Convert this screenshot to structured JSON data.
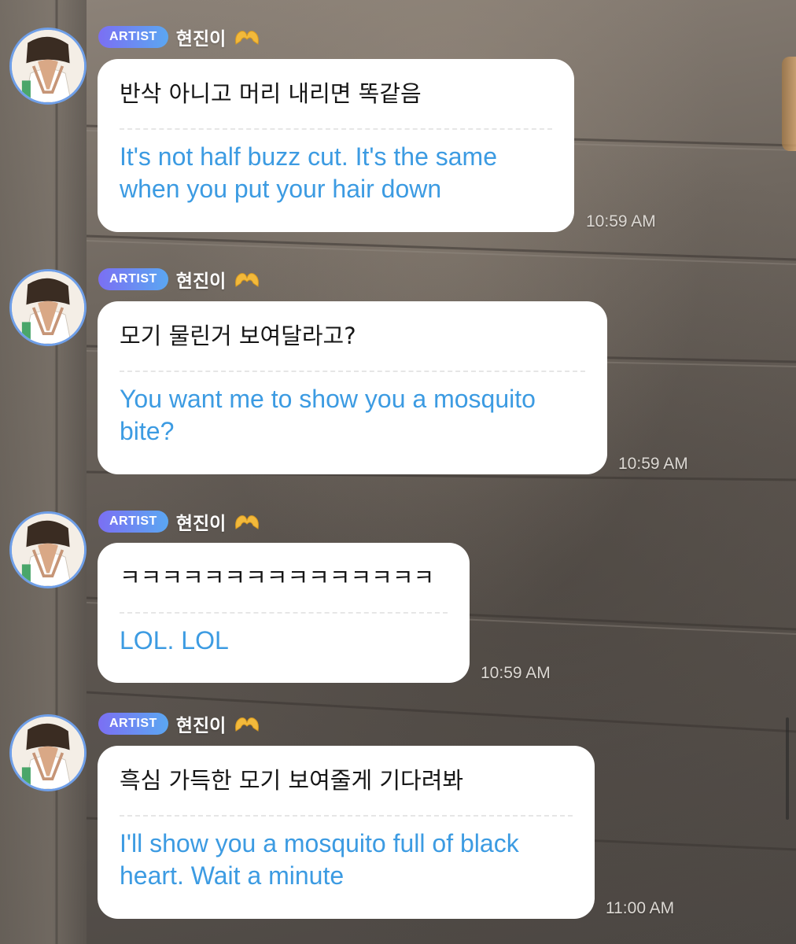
{
  "messages": [
    {
      "badge": "ARTIST",
      "username": "현진이",
      "original": "반삭 아니고 머리 내리면 똑같음",
      "translation": "It's not half buzz cut. It's the same when you put your hair down",
      "time": "10:59 AM"
    },
    {
      "badge": "ARTIST",
      "username": "현진이",
      "original": "모기 물린거 보여달라고?",
      "translation": "You want me to show you a mosquito bite?",
      "time": "10:59 AM"
    },
    {
      "badge": "ARTIST",
      "username": "현진이",
      "original": "ㅋㅋㅋㅋㅋㅋㅋㅋㅋㅋㅋㅋㅋㅋㅋ",
      "translation": "LOL. LOL",
      "time": "10:59 AM"
    },
    {
      "badge": "ARTIST",
      "username": "현진이",
      "original": "흑심 가득한 모기 보여줄게 기다려봐",
      "translation": "I'll show you a mosquito full of black heart. Wait a minute",
      "time": "11:00 AM"
    }
  ],
  "icons": {
    "name_emoji": "heart-hands-icon",
    "avatar": "avatar-photo"
  },
  "colors": {
    "badge_start": "#7b6ff3",
    "badge_end": "#5ba7f2",
    "translation_text": "#3c9be2",
    "avatar_ring": "#6f9fe8"
  }
}
